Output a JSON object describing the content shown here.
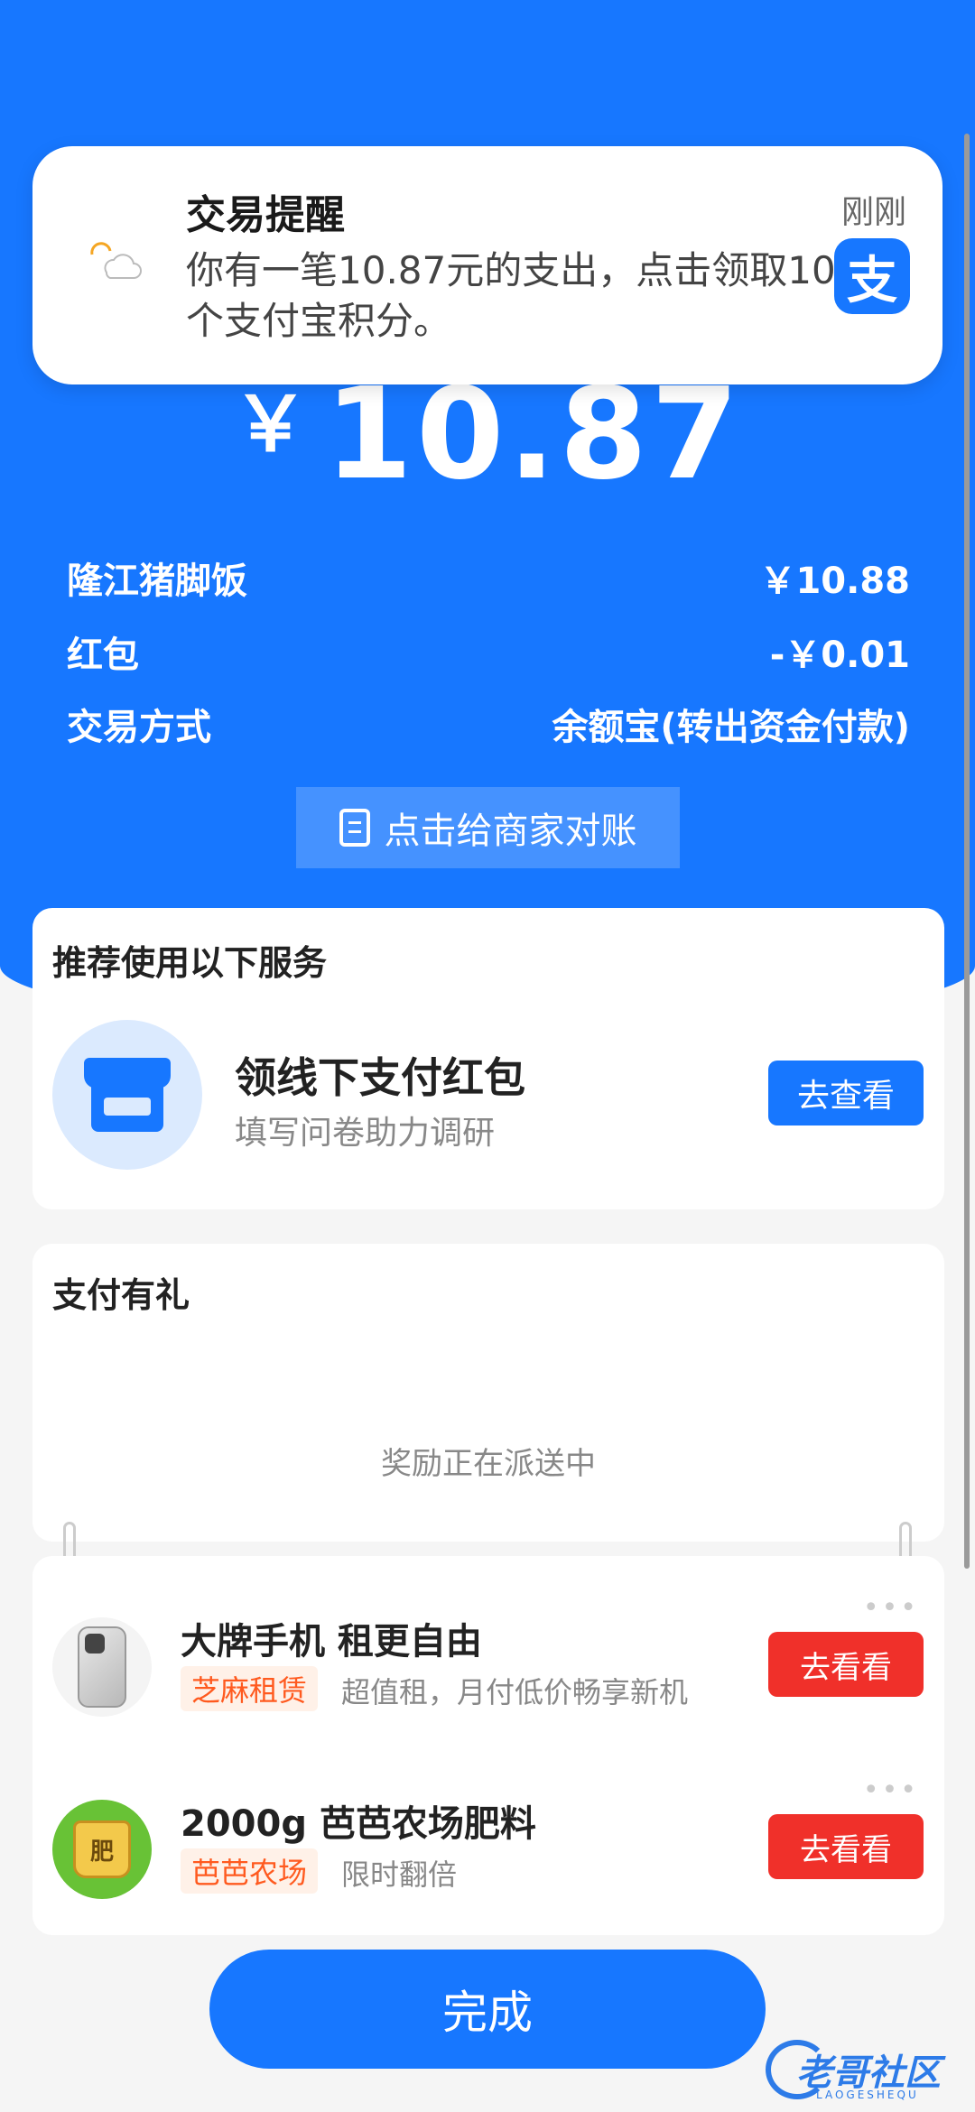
{
  "notification": {
    "title": "交易提醒",
    "time": "刚刚",
    "body": "你有一笔10.87元的支出，点击领取10个支付宝积分。",
    "app_icon_glyph": "支",
    "app_icon": "alipay-logo-icon"
  },
  "payment": {
    "currency_symbol": "￥",
    "amount": "10.87",
    "rows": [
      {
        "label": "隆江猪脚饭",
        "value": "￥10.88"
      },
      {
        "label": "红包",
        "value": "-￥0.01"
      },
      {
        "label": "交易方式",
        "value": "余额宝(转出资金付款)"
      }
    ],
    "reconcile_label": "点击给商家对账"
  },
  "recommend": {
    "title": "推荐使用以下服务",
    "item_title": "领线下支付红包",
    "item_subtitle": "填写问卷助力调研",
    "button": "去查看",
    "icon": "store-icon"
  },
  "gift": {
    "title": "支付有礼",
    "status": "奖励正在派送中"
  },
  "offers": [
    {
      "title": "大牌手机 租更自由",
      "tag": "芝麻租赁",
      "desc": "超值租，月付低价畅享新机",
      "button": "去看看",
      "icon": "phone-icon"
    },
    {
      "title": "2000g 芭芭农场肥料",
      "tag": "芭芭农场",
      "desc": "限时翻倍",
      "button": "去看看",
      "icon": "fertilizer-bag-icon",
      "icon_text": "肥"
    }
  ],
  "done_label": "完成",
  "watermark": {
    "text": "老哥社区",
    "sub": "LAOGESHEQU"
  },
  "colors": {
    "primary": "#1777ff",
    "danger": "#f0302a",
    "tag_text": "#ff5a1f",
    "background": "#f5f5f5"
  }
}
